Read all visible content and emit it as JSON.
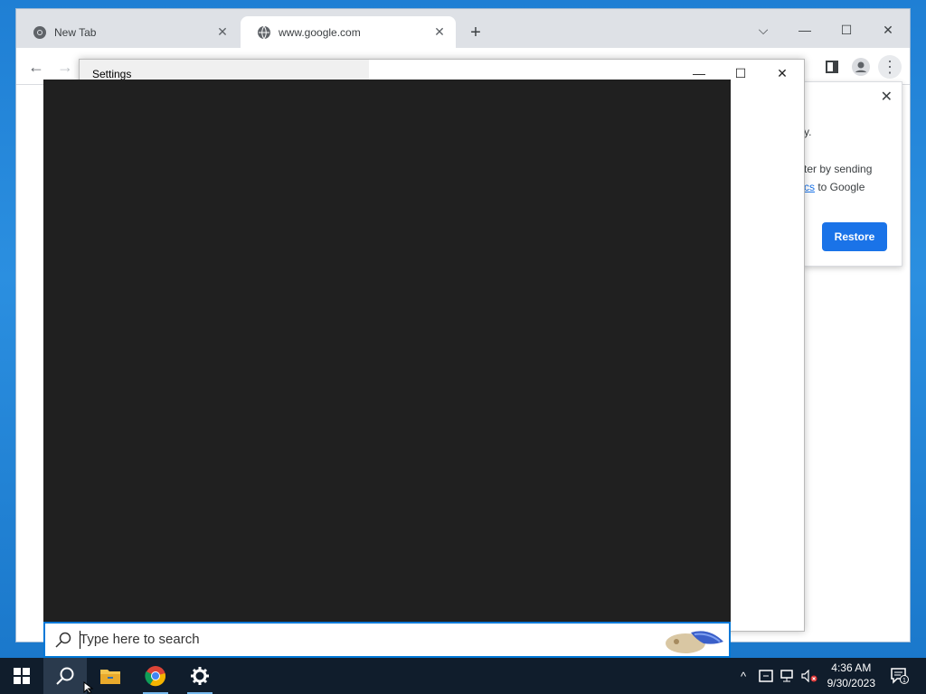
{
  "browser": {
    "tabs": [
      {
        "label": "New Tab",
        "icon": "chrome-icon"
      },
      {
        "label": "www.google.com",
        "icon": "globe-icon"
      }
    ],
    "new_tab_symbol": "+",
    "controls": {
      "dropdown": "⌵",
      "minimize": "—",
      "maximize": "☐",
      "close": "✕"
    }
  },
  "restore_popup": {
    "line1": "y.",
    "line2": "ter by sending",
    "line3_link": "cs",
    "line3_rest": " to Google",
    "button_label": "Restore",
    "close_symbol": "✕"
  },
  "settings_window": {
    "title": "Settings",
    "controls": {
      "minimize": "—",
      "maximize": "☐",
      "close": "✕"
    }
  },
  "search": {
    "placeholder": "Type here to search"
  },
  "taskbar": {
    "time": "4:36 AM",
    "date": "9/30/2023",
    "notification_count": "1"
  },
  "colors": {
    "accent": "#1a73e8",
    "search_border": "#0078d7",
    "taskbar_bg": "#101d2c",
    "search_panel_bg": "#202020"
  }
}
